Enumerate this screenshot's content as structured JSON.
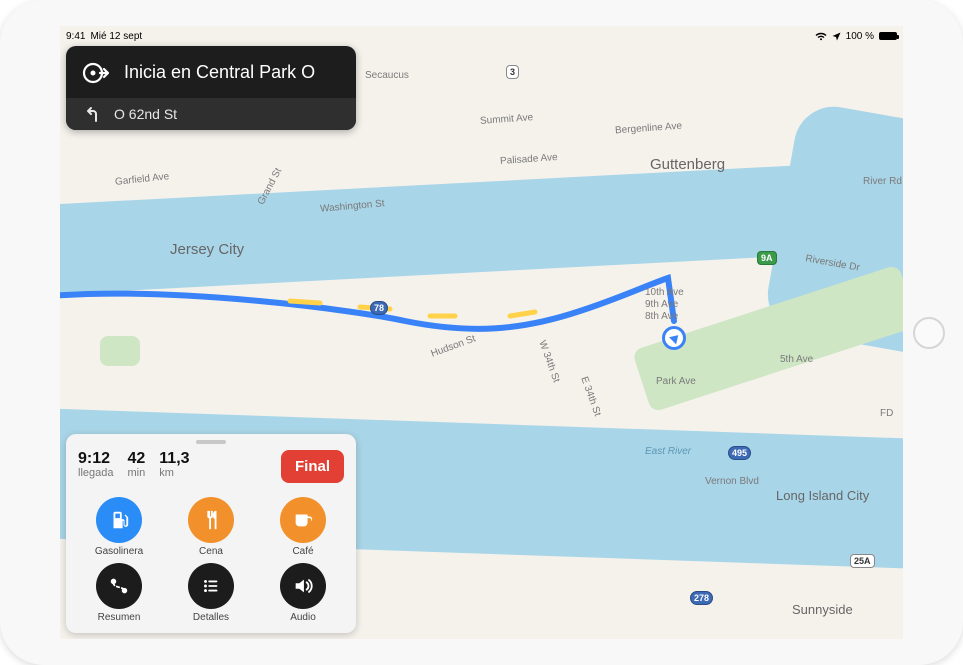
{
  "status": {
    "time": "9:41",
    "date": "Mié 12 sept",
    "battery_pct": "100 %"
  },
  "direction": {
    "main": "Inicia en Central Park O",
    "next": "O 62nd St"
  },
  "nav": {
    "arrival_val": "9:12",
    "arrival_lbl": "llegada",
    "duration_val": "42",
    "duration_lbl": "min",
    "distance_val": "11,3",
    "distance_lbl": "km",
    "end_label": "Final"
  },
  "quick": {
    "gas": "Gasolinera",
    "dinner": "Cena",
    "coffee": "Café",
    "overview": "Resumen",
    "details": "Detalles",
    "audio": "Audio"
  },
  "map": {
    "jersey_city": "Jersey City",
    "guttenberg": "Guttenberg",
    "long_island_city": "Long Island City",
    "sunnyside": "Sunnyside",
    "secaucus": "Secaucus",
    "garfield_ave": "Garfield Ave",
    "grand_st": "Grand St",
    "washington_st": "Washington St",
    "summit_ave": "Summit Ave",
    "palisade_ave": "Palisade Ave",
    "bergenline_ave": "Bergenline Ave",
    "riverside_dr": "Riverside Dr",
    "river_rd": "River Rd",
    "hudson_st": "Hudson St",
    "tenth_ave": "10th Ave",
    "ninth_ave": "9th Ave",
    "eighth_ave": "8th Ave",
    "fifth_ave": "5th Ave",
    "park_ave": "Park Ave",
    "fdr": "FD",
    "w34": "W 34th St",
    "e34": "E 34th St",
    "east_river": "East River",
    "vernon_blvd": "Vernon Blvd",
    "s3": "3",
    "s9a": "9A",
    "s78": "78",
    "s495": "495",
    "s278": "278",
    "s25a": "25A"
  }
}
